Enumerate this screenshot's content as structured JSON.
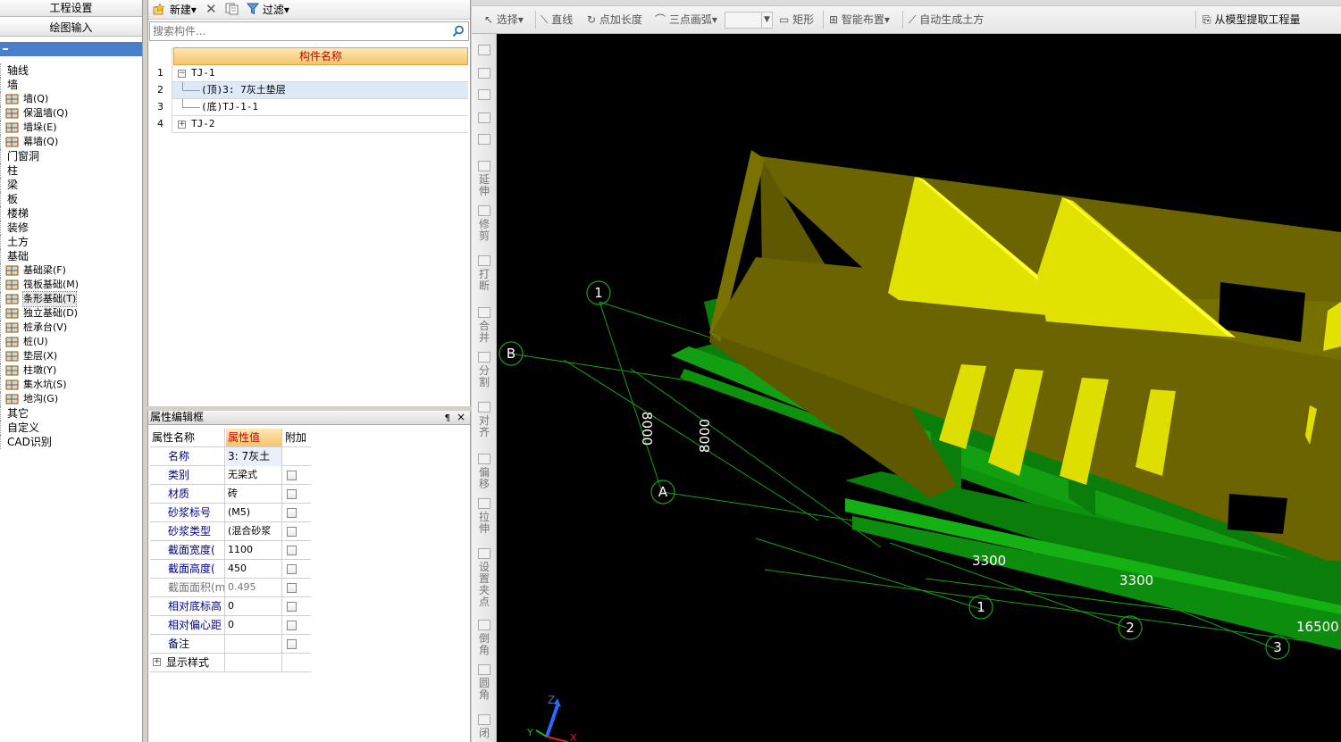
{
  "nav": {
    "tab_project": "工程设置",
    "tab_draw": "绘图输入",
    "tree": [
      {
        "label": "轴线",
        "level": 0
      },
      {
        "label": "墙",
        "level": 0
      },
      {
        "label": "墙(Q)",
        "level": 1,
        "icon": "wall-icon"
      },
      {
        "label": "保温墙(Q)",
        "level": 1,
        "icon": "insulation-wall-icon"
      },
      {
        "label": "墙垛(E)",
        "level": 1,
        "icon": "wall-pier-icon"
      },
      {
        "label": "幕墙(Q)",
        "level": 1,
        "icon": "curtain-wall-icon"
      },
      {
        "label": "门窗洞",
        "level": 0
      },
      {
        "label": "柱",
        "level": 0
      },
      {
        "label": "梁",
        "level": 0
      },
      {
        "label": "板",
        "level": 0
      },
      {
        "label": "楼梯",
        "level": 0
      },
      {
        "label": "装修",
        "level": 0
      },
      {
        "label": "土方",
        "level": 0
      },
      {
        "label": "基础",
        "level": 0
      },
      {
        "label": "基础梁(F)",
        "level": 1,
        "icon": "foundation-beam-icon"
      },
      {
        "label": "筏板基础(M)",
        "level": 1,
        "icon": "raft-foundation-icon"
      },
      {
        "label": "条形基础(T)",
        "level": 1,
        "icon": "strip-foundation-icon",
        "selected": true
      },
      {
        "label": "独立基础(D)",
        "level": 1,
        "icon": "isolated-foundation-icon"
      },
      {
        "label": "桩承台(V)",
        "level": 1,
        "icon": "pile-cap-icon"
      },
      {
        "label": "桩(U)",
        "level": 1,
        "icon": "pile-icon"
      },
      {
        "label": "垫层(X)",
        "level": 1,
        "icon": "cushion-layer-icon"
      },
      {
        "label": "柱墩(Y)",
        "level": 1,
        "icon": "column-pier-icon"
      },
      {
        "label": "集水坑(S)",
        "level": 1,
        "icon": "sump-pit-icon"
      },
      {
        "label": "地沟(G)",
        "level": 1,
        "icon": "trench-icon"
      },
      {
        "label": "其它",
        "level": 0
      },
      {
        "label": "自定义",
        "level": 0
      },
      {
        "label": "CAD识别",
        "level": 0
      }
    ]
  },
  "component_panel": {
    "new_label": "新建",
    "filter_label": "过滤",
    "search_placeholder": "搜索构件...",
    "column_header": "构件名称",
    "rows": [
      {
        "num": "1",
        "name": "TJ-1",
        "expander": "−",
        "selected": false
      },
      {
        "num": "2",
        "name": "(顶)3: 7灰土垫层",
        "expander": "",
        "selected": true
      },
      {
        "num": "3",
        "name": "(底)TJ-1-1",
        "expander": "",
        "selected": false
      },
      {
        "num": "4",
        "name": "TJ-2",
        "expander": "+",
        "selected": false
      }
    ]
  },
  "property_panel": {
    "title": "属性编辑框",
    "pin": "¶",
    "close": "×",
    "headers": {
      "name": "属性名称",
      "value": "属性值",
      "extra": "附加"
    },
    "rows": [
      {
        "name": "名称",
        "value": "3: 7灰土",
        "checkbox": false
      },
      {
        "name": "类别",
        "value": "无梁式",
        "checkbox": true
      },
      {
        "name": "材质",
        "value": "砖",
        "checkbox": true
      },
      {
        "name": "砂浆标号",
        "value": "(M5)",
        "checkbox": true
      },
      {
        "name": "砂浆类型",
        "value": "(混合砂浆",
        "checkbox": true
      },
      {
        "name": "截面宽度(",
        "value": "1100",
        "checkbox": true
      },
      {
        "name": "截面高度(",
        "value": "450",
        "checkbox": true
      },
      {
        "name": "截面面积(m",
        "value": "0.495",
        "checkbox": true,
        "muted": true
      },
      {
        "name": "相对底标高",
        "value": "0",
        "checkbox": true
      },
      {
        "name": "相对偏心距",
        "value": "0",
        "checkbox": true
      },
      {
        "name": "备注",
        "value": "",
        "checkbox": true
      },
      {
        "name": "显示样式",
        "value": "",
        "checkbox": false,
        "expander": "+"
      }
    ]
  },
  "draw_toolbar": {
    "select": "选择",
    "line": "直线",
    "point_length": "点加长度",
    "arc": "三点画弧",
    "rect": "矩形",
    "smart_layout": "智能布置",
    "auto_earth": "自动生成土方",
    "extract": "从模型提取工程量"
  },
  "edit_toolbar": {
    "items": [
      "延伸",
      "修剪",
      "打断",
      "合并",
      "分割",
      "对齐",
      "偏移",
      "拉伸",
      "设置夹点",
      "倒角",
      "圆角",
      "闭"
    ]
  },
  "viewport": {
    "axis_labels": {
      "B": "B",
      "A": "A",
      "a1": "1",
      "g1": "1",
      "g2": "2",
      "g3": "3"
    },
    "dims": {
      "d8000a": "8000",
      "d8000b": "8000",
      "d3300a": "3300",
      "d3300b": "3300",
      "d16500": "16500"
    },
    "triad": {
      "z": "Z",
      "y": "Y",
      "x": "X"
    },
    "colors": {
      "wall": "#6b6400",
      "foundation": "#0b8c0b",
      "slab": "#e0e000",
      "axis": "#1aa01a"
    }
  }
}
